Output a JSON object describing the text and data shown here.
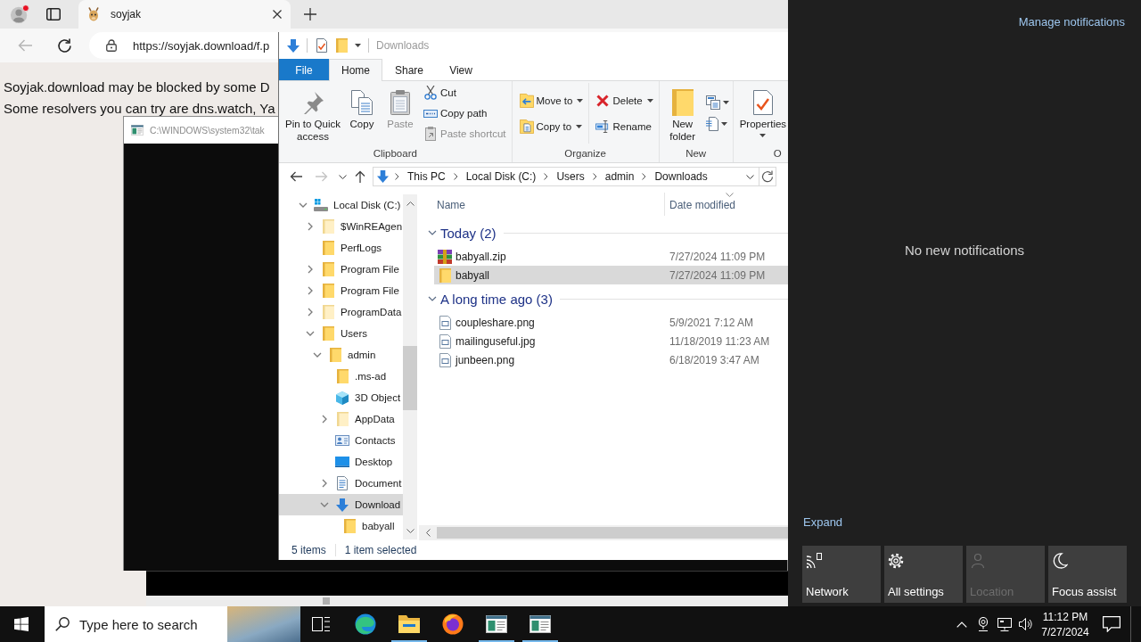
{
  "browser": {
    "tabs": [
      {
        "title": "soyjak",
        "selected": true
      }
    ],
    "nav_buttons": [
      {
        "kind": "back",
        "disabled": true
      },
      {
        "kind": "refresh",
        "disabled": false
      }
    ],
    "url": "https://soyjak.download/f.p",
    "page_lines": [
      "Soyjak.download may be blocked by some D",
      "Some resolvers you can try are dns.watch, Ya"
    ]
  },
  "console_window": {
    "title": "C:\\WINDOWS\\system32\\tak"
  },
  "explorer": {
    "title": "Downloads",
    "ribbon_tabs": [
      {
        "label": "File",
        "kind": "menu",
        "selected": false
      },
      {
        "label": "Home",
        "kind": "tab",
        "selected": true
      },
      {
        "label": "Share",
        "kind": "tab",
        "selected": false
      },
      {
        "label": "View",
        "kind": "tab",
        "selected": false
      }
    ],
    "ribbon_groups": [
      {
        "label": "Clipboard",
        "items": [
          {
            "kind": "large",
            "label": "Pin to Quick access",
            "disabled": false,
            "dropdown": false
          },
          {
            "kind": "large",
            "label": "Copy",
            "disabled": false,
            "dropdown": false
          },
          {
            "kind": "large",
            "label": "Paste",
            "disabled": true,
            "dropdown": false
          },
          {
            "kind": "stack",
            "items": [
              {
                "label": "Cut",
                "disabled": false,
                "dropdown": false
              },
              {
                "label": "Copy path",
                "disabled": false,
                "dropdown": false
              },
              {
                "label": "Paste shortcut",
                "disabled": true,
                "dropdown": false
              }
            ]
          }
        ]
      },
      {
        "label": "Organize",
        "items": [
          {
            "kind": "stack",
            "items": [
              {
                "label": "Move to",
                "disabled": false,
                "dropdown": true
              },
              {
                "label": "Copy to",
                "disabled": false,
                "dropdown": true
              }
            ]
          },
          {
            "kind": "stack",
            "items": [
              {
                "label": "Delete",
                "disabled": false,
                "dropdown": true
              },
              {
                "label": "Rename",
                "disabled": false,
                "dropdown": false
              }
            ]
          }
        ]
      },
      {
        "label": "New",
        "items": [
          {
            "kind": "large",
            "label": "New folder",
            "disabled": false,
            "dropdown": false
          },
          {
            "kind": "icon_stack",
            "items": [
              {
                "dropdown": true
              },
              {
                "dropdown": true
              }
            ]
          }
        ]
      },
      {
        "label": "O",
        "items": [
          {
            "kind": "large",
            "label": "Properties",
            "disabled": false,
            "dropdown": true
          }
        ]
      }
    ],
    "nav_buttons": [
      {
        "kind": "back",
        "disabled": false
      },
      {
        "kind": "forward",
        "disabled": true
      },
      {
        "kind": "recent",
        "disabled": false
      },
      {
        "kind": "up",
        "disabled": false
      }
    ],
    "breadcrumbs": [
      "This PC",
      "Local Disk (C:)",
      "Users",
      "admin",
      "Downloads"
    ],
    "nav_tree": [
      {
        "label": "Local Disk (C:)",
        "kind": "drive",
        "has_children": true,
        "expanded": true,
        "selected": false,
        "children": [
          {
            "label": "$WinREAgen",
            "kind": "hidden_folder",
            "has_children": true,
            "expanded": false,
            "selected": false
          },
          {
            "label": "PerfLogs",
            "kind": "folder",
            "has_children": false,
            "expanded": false,
            "selected": false
          },
          {
            "label": "Program File",
            "kind": "folder",
            "has_children": true,
            "expanded": false,
            "selected": false
          },
          {
            "label": "Program File",
            "kind": "folder",
            "has_children": true,
            "expanded": false,
            "selected": false
          },
          {
            "label": "ProgramData",
            "kind": "hidden_folder",
            "has_children": true,
            "expanded": false,
            "selected": false
          },
          {
            "label": "Users",
            "kind": "folder",
            "has_children": true,
            "expanded": true,
            "selected": false,
            "children": [
              {
                "label": "admin",
                "kind": "folder",
                "has_children": true,
                "expanded": true,
                "selected": false,
                "children": [
                  {
                    "label": ".ms-ad",
                    "kind": "folder",
                    "has_children": false,
                    "expanded": false,
                    "selected": false
                  },
                  {
                    "label": "3D Object",
                    "kind": "objects_3d",
                    "has_children": false,
                    "expanded": false,
                    "selected": false
                  },
                  {
                    "label": "AppData",
                    "kind": "hidden_folder",
                    "has_children": true,
                    "expanded": false,
                    "selected": false
                  },
                  {
                    "label": "Contacts",
                    "kind": "contacts",
                    "has_children": false,
                    "expanded": false,
                    "selected": false
                  },
                  {
                    "label": "Desktop",
                    "kind": "desktop",
                    "has_children": false,
                    "expanded": false,
                    "selected": false
                  },
                  {
                    "label": "Document",
                    "kind": "documents",
                    "has_children": true,
                    "expanded": false,
                    "selected": false
                  },
                  {
                    "label": "Download",
                    "kind": "downloads",
                    "has_children": true,
                    "expanded": true,
                    "selected": true,
                    "children": [
                      {
                        "label": "babyall",
                        "kind": "folder",
                        "has_children": false,
                        "expanded": false,
                        "selected": false
                      }
                    ]
                  }
                ]
              }
            ]
          }
        ]
      }
    ],
    "columns": [
      {
        "label": "Name",
        "sorted": false
      },
      {
        "label": "Date modified",
        "sorted": true
      }
    ],
    "file_groups": [
      {
        "label": "Today (2)",
        "expanded": true,
        "files": [
          {
            "name": "babyall.zip",
            "kind": "archive",
            "date": "7/27/2024 11:09 PM",
            "selected": false
          },
          {
            "name": "babyall",
            "kind": "folder",
            "date": "7/27/2024 11:09 PM",
            "selected": true
          }
        ]
      },
      {
        "label": "A long time ago (3)",
        "expanded": true,
        "files": [
          {
            "name": "coupleshare.png",
            "kind": "image",
            "date": "5/9/2021 7:12 AM",
            "selected": false
          },
          {
            "name": "mailinguseful.jpg",
            "kind": "image",
            "date": "11/18/2019 11:23 AM",
            "selected": false
          },
          {
            "name": "junbeen.png",
            "kind": "image",
            "date": "6/18/2019 3:47 AM",
            "selected": false
          }
        ]
      }
    ],
    "status_bar": {
      "item_count": "5 items",
      "selection": "1 item selected"
    }
  },
  "action_center": {
    "manage_link": "Manage notifications",
    "empty_message": "No new notifications",
    "expand_link": "Expand",
    "quick_actions": [
      {
        "label": "Network",
        "kind": "network",
        "disabled": false
      },
      {
        "label": "All settings",
        "kind": "settings",
        "disabled": false
      },
      {
        "label": "Location",
        "kind": "location",
        "disabled": true
      },
      {
        "label": "Focus assist",
        "kind": "focus",
        "disabled": false
      }
    ]
  },
  "taskbar": {
    "search_placeholder": "Type here to search",
    "apps": [
      {
        "kind": "task_view",
        "running": false
      },
      {
        "kind": "edge",
        "running": false
      },
      {
        "kind": "explorer",
        "running": true
      },
      {
        "kind": "firefox",
        "running": false
      },
      {
        "kind": "window",
        "running": true
      },
      {
        "kind": "window",
        "running": true
      }
    ],
    "clock": {
      "time": "11:12 PM",
      "date": "7/27/2024"
    }
  }
}
